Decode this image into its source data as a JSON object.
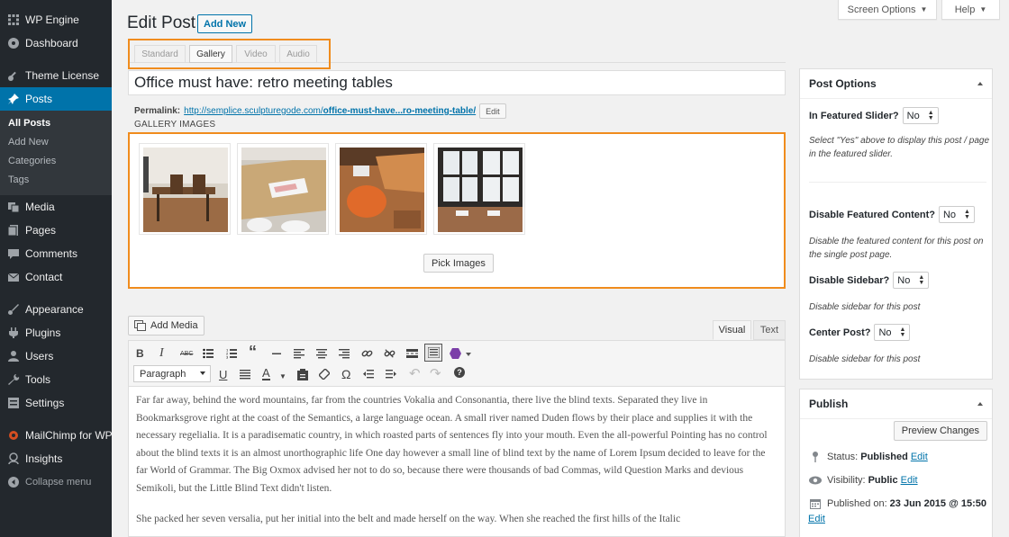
{
  "sidebar": {
    "items": [
      {
        "label": "WP Engine",
        "icon": "wp-engine-icon"
      },
      {
        "label": "Dashboard",
        "icon": "dashboard-icon"
      },
      {
        "label": "Theme License",
        "icon": "key-icon"
      },
      {
        "label": "Posts",
        "icon": "pushpin-icon"
      },
      {
        "label": "Media",
        "icon": "media-icon"
      },
      {
        "label": "Pages",
        "icon": "pages-icon"
      },
      {
        "label": "Comments",
        "icon": "comments-icon"
      },
      {
        "label": "Contact",
        "icon": "mail-icon"
      },
      {
        "label": "Appearance",
        "icon": "paintbrush-icon"
      },
      {
        "label": "Plugins",
        "icon": "plugin-icon"
      },
      {
        "label": "Users",
        "icon": "users-icon"
      },
      {
        "label": "Tools",
        "icon": "wrench-icon"
      },
      {
        "label": "Settings",
        "icon": "settings-icon"
      },
      {
        "label": "MailChimp for WP",
        "icon": "mailchimp-icon"
      },
      {
        "label": "Insights",
        "icon": "insights-icon"
      },
      {
        "label": "Collapse menu",
        "icon": "collapse-icon"
      }
    ],
    "posts_submenu": [
      "All Posts",
      "Add New",
      "Categories",
      "Tags"
    ]
  },
  "top": {
    "screen_options": "Screen Options",
    "help": "Help"
  },
  "header": {
    "title": "Edit Post",
    "add_new": "Add New"
  },
  "formats": [
    "Standard",
    "Gallery",
    "Video",
    "Audio"
  ],
  "post": {
    "title": "Office must have: retro meeting tables",
    "permalink_label": "Permalink:",
    "permalink_base": "http://semplice.sculpturegode.com/",
    "permalink_slug": "office-must-have...ro-meeting-table/",
    "edit": "Edit"
  },
  "gallery": {
    "label": "GALLERY IMAGES",
    "pick_images": "Pick Images"
  },
  "editor": {
    "add_media": "Add Media",
    "tab_visual": "Visual",
    "tab_text": "Text",
    "paragraph": "Paragraph",
    "content": [
      "Far far away, behind the word mountains, far from the countries Vokalia and Consonantia, there live the blind texts. Separated they live in Bookmarksgrove right at the coast of the Semantics, a large language ocean. A small river named Duden flows by their place and supplies it with the necessary regelialia. It is a paradisematic country, in which roasted parts of sentences fly into your mouth. Even the all-powerful Pointing has no control about the blind texts it is an almost unorthographic life One day however a small line of blind text by the name of Lorem Ipsum decided to leave for the far World of Grammar. The Big Oxmox advised her not to do so, because there were thousands of bad Commas, wild Question Marks and devious Semikoli, but the Little Blind Text didn't listen.",
      "She packed her seven versalia, put her initial into the belt and made herself on the way. When she reached the first hills of the Italic"
    ]
  },
  "post_options": {
    "title": "Post Options",
    "featured_slider_label": "In Featured Slider?",
    "featured_slider_value": "No",
    "featured_slider_desc": "Select \"Yes\" above to display this post / page in the featured slider.",
    "disable_featured_label": "Disable Featured Content?",
    "disable_featured_value": "No",
    "disable_featured_desc": "Disable the featured content for this post on the single post page.",
    "disable_sidebar_label": "Disable Sidebar?",
    "disable_sidebar_value": "No",
    "disable_sidebar_desc": "Disable sidebar for this post",
    "center_post_label": "Center Post?",
    "center_post_value": "No",
    "center_post_desc": "Disable sidebar for this post"
  },
  "publish": {
    "title": "Publish",
    "preview": "Preview Changes",
    "status_label": "Status:",
    "status_value": "Published",
    "visibility_label": "Visibility:",
    "visibility_value": "Public",
    "published_label": "Published on:",
    "published_value": "23 Jun 2015 @ 15:50",
    "edit": "Edit"
  }
}
